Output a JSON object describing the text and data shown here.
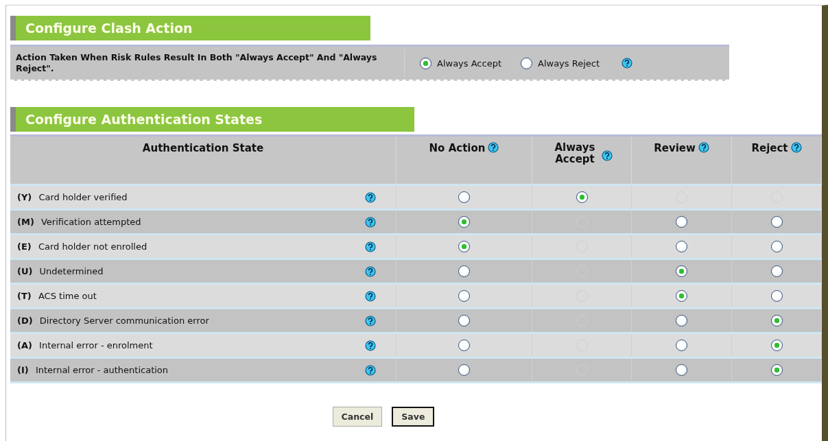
{
  "clash_section": {
    "title": "Configure Clash Action",
    "question": "Action Taken When Risk Rules Result In Both \"Always Accept\" And \"Always Reject\".",
    "options": [
      {
        "label": "Always Accept",
        "selected": true
      },
      {
        "label": "Always Reject",
        "selected": false
      }
    ],
    "help": true
  },
  "auth_section": {
    "title": "Configure Authentication States",
    "columns": [
      {
        "label": "Authentication State",
        "help": false
      },
      {
        "label": "No Action",
        "help": true
      },
      {
        "label": "Always Accept",
        "help": true
      },
      {
        "label": "Review",
        "help": true
      },
      {
        "label": "Reject",
        "help": true
      }
    ],
    "rows": [
      {
        "code": "(Y)",
        "label": "Card holder verified",
        "help": true,
        "cells": [
          {
            "selected": false,
            "disabled": false
          },
          {
            "selected": true,
            "disabled": false
          },
          {
            "disabled": true
          },
          {
            "disabled": true
          }
        ]
      },
      {
        "code": "(M)",
        "label": "Verification attempted",
        "help": true,
        "cells": [
          {
            "selected": true,
            "disabled": false
          },
          {
            "disabled": true
          },
          {
            "selected": false,
            "disabled": false
          },
          {
            "selected": false,
            "disabled": false
          }
        ]
      },
      {
        "code": "(E)",
        "label": "Card holder not enrolled",
        "help": true,
        "cells": [
          {
            "selected": true,
            "disabled": false
          },
          {
            "disabled": true
          },
          {
            "selected": false,
            "disabled": false
          },
          {
            "selected": false,
            "disabled": false
          }
        ]
      },
      {
        "code": "(U)",
        "label": "Undetermined",
        "help": true,
        "cells": [
          {
            "selected": false,
            "disabled": false
          },
          {
            "disabled": true
          },
          {
            "selected": true,
            "disabled": false
          },
          {
            "selected": false,
            "disabled": false
          }
        ]
      },
      {
        "code": "(T)",
        "label": "ACS time out",
        "help": true,
        "cells": [
          {
            "selected": false,
            "disabled": false
          },
          {
            "disabled": true
          },
          {
            "selected": true,
            "disabled": false
          },
          {
            "selected": false,
            "disabled": false
          }
        ]
      },
      {
        "code": "(D)",
        "label": "Directory Server communication error",
        "help": true,
        "cells": [
          {
            "selected": false,
            "disabled": false
          },
          {
            "disabled": true
          },
          {
            "selected": false,
            "disabled": false
          },
          {
            "selected": true,
            "disabled": false
          }
        ]
      },
      {
        "code": "(A)",
        "label": "Internal error - enrolment",
        "help": true,
        "cells": [
          {
            "selected": false,
            "disabled": false
          },
          {
            "disabled": true
          },
          {
            "selected": false,
            "disabled": false
          },
          {
            "selected": true,
            "disabled": false
          }
        ]
      },
      {
        "code": "(I)",
        "label": "Internal error - authentication",
        "help": true,
        "cells": [
          {
            "selected": false,
            "disabled": false
          },
          {
            "disabled": true
          },
          {
            "selected": false,
            "disabled": false
          },
          {
            "selected": true,
            "disabled": false
          }
        ]
      }
    ]
  },
  "buttons": [
    {
      "label": "Cancel",
      "kind": "normal"
    },
    {
      "label": "Save",
      "kind": "default"
    }
  ]
}
